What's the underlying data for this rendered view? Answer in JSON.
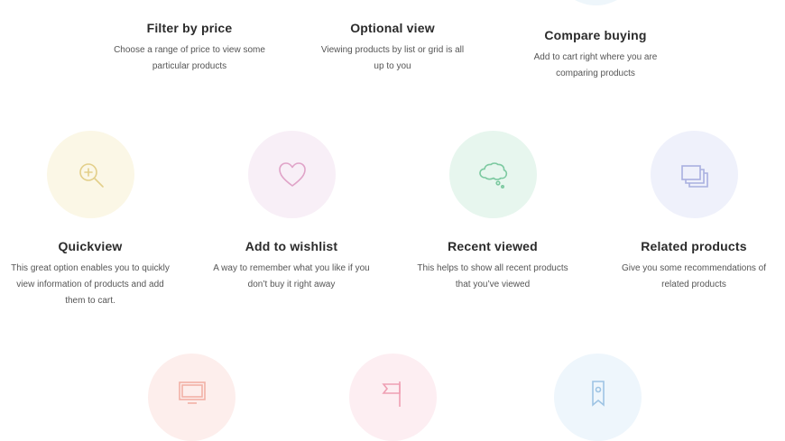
{
  "colors": {
    "quickview_bg": "#fbf7e6",
    "quickview_icon": "#e3cf8a",
    "wishlist_bg": "#f8eff7",
    "wishlist_icon": "#e0a3c8",
    "recent_bg": "#e7f6ee",
    "recent_icon": "#7cc9a0",
    "related_bg": "#eff1fb",
    "related_icon": "#a9b0e0",
    "row3_a_bg": "#fdeeec",
    "row3_a_icon": "#f2b1a6",
    "row3_b_bg": "#fdeef2",
    "row3_b_icon": "#ef9fb3",
    "row3_c_bg": "#eef6fc",
    "row3_c_icon": "#9ec4e4"
  },
  "top_row": [
    {
      "title": "Filter by price",
      "desc_line1": "Choose a range of price to view some",
      "desc_line2": "particular products"
    },
    {
      "title": "Optional view",
      "desc_line1": "Viewing products by list or grid is all",
      "desc_line2": "up to you"
    },
    {
      "title": "Compare buying",
      "desc_line1": "Add to cart right where you are",
      "desc_line2": "comparing products"
    }
  ],
  "middle_row": [
    {
      "title": "Quickview",
      "icon": "magnifier-plus-icon",
      "desc_line1": "This great option enables you to quickly",
      "desc_line2": "view information of products and add",
      "desc_line3": "them to cart."
    },
    {
      "title": "Add to wishlist",
      "icon": "heart-icon",
      "desc_line1": "A way to remember what you like if you",
      "desc_line2": "don’t buy it right away"
    },
    {
      "title": "Recent viewed",
      "icon": "thought-bubble-icon",
      "desc_line1": "This helps to show all recent products",
      "desc_line2": "that you’ve viewed"
    },
    {
      "title": "Related products",
      "icon": "stacked-windows-icon",
      "desc_line1": "Give you some recommendations of",
      "desc_line2": "related products"
    }
  ],
  "bottom_row": [
    {
      "icon": "monitor-icon"
    },
    {
      "icon": "flag-icon"
    },
    {
      "icon": "bookmark-icon"
    }
  ]
}
